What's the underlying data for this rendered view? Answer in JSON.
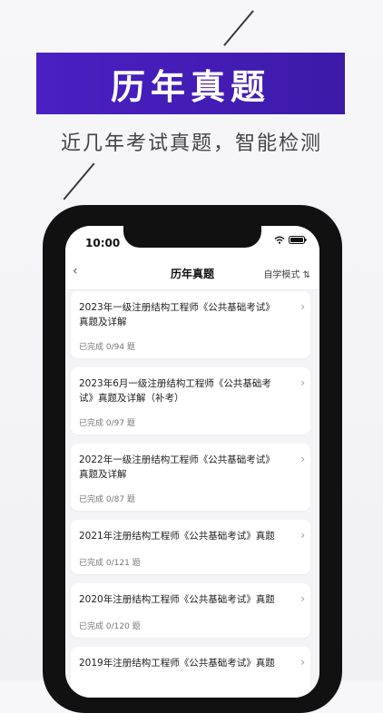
{
  "hero": {
    "title": "历年真题",
    "subtitle": "近几年考试真题，智能检测"
  },
  "status_bar": {
    "time": "10:00"
  },
  "nav": {
    "title": "历年真题",
    "mode_label": "自学模式 ⇅"
  },
  "papers": [
    {
      "title": "2023年一级注册结构工程师《公共基础考试》真题及详解",
      "progress": "已完成 0/94 题"
    },
    {
      "title": "2023年6月一级注册结构工程师《公共基础考试》真题及详解（补考）",
      "progress": "已完成 0/97 题"
    },
    {
      "title": "2022年一级注册结构工程师《公共基础考试》真题及详解",
      "progress": "已完成 0/87 题"
    },
    {
      "title": "2021年注册结构工程师《公共基础考试》真题",
      "progress": "已完成 0/121 题"
    },
    {
      "title": "2020年注册结构工程师《公共基础考试》真题",
      "progress": "已完成 0/120 题"
    },
    {
      "title": "2019年注册结构工程师《公共基础考试》真题",
      "progress": ""
    }
  ]
}
